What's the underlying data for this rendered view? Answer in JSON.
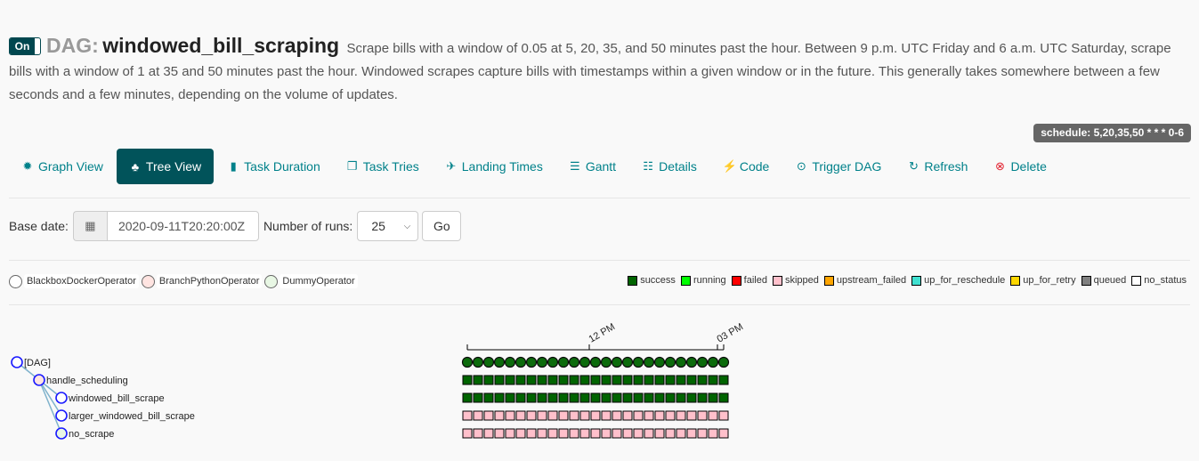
{
  "header": {
    "toggle_label": "On",
    "dag_prefix": "DAG:",
    "dag_id": "windowed_bill_scraping",
    "description": "Scrape bills with a window of 0.05 at 5, 20, 35, and 50 minutes past the hour. Between 9 p.m. UTC Friday and 6 a.m. UTC Saturday, scrape bills with a window of 1 at 35 and 50 minutes past the hour. Windowed scrapes capture bills with timestamps within a given window or in the future. This generally takes somewhere between a few seconds and a few minutes, depending on the volume of updates.",
    "schedule_badge": "schedule: 5,20,35,50 * * * 0-6"
  },
  "nav": {
    "items": [
      {
        "label": "Graph View",
        "icon": "graph-icon",
        "glyph": "✹",
        "active": false
      },
      {
        "label": "Tree View",
        "icon": "tree-icon",
        "glyph": "♣",
        "active": true
      },
      {
        "label": "Task Duration",
        "icon": "bar-chart-icon",
        "glyph": "▮",
        "active": false
      },
      {
        "label": "Task Tries",
        "icon": "duplicate-icon",
        "glyph": "❐",
        "active": false
      },
      {
        "label": "Landing Times",
        "icon": "plane-icon",
        "glyph": "✈",
        "active": false
      },
      {
        "label": "Gantt",
        "icon": "gantt-icon",
        "glyph": "☰",
        "active": false
      },
      {
        "label": "Details",
        "icon": "list-icon",
        "glyph": "☷",
        "active": false
      },
      {
        "label": "Code",
        "icon": "flash-icon",
        "glyph": "⚡",
        "active": false
      },
      {
        "label": "Trigger DAG",
        "icon": "play-circle-icon",
        "glyph": "⊙",
        "active": false
      },
      {
        "label": "Refresh",
        "icon": "refresh-icon",
        "glyph": "↻",
        "active": false
      },
      {
        "label": "Delete",
        "icon": "remove-circle-icon",
        "glyph": "⊗",
        "active": false
      }
    ]
  },
  "form": {
    "base_date_label": "Base date:",
    "calendar_glyph": "▦",
    "base_date_value": "2020-09-11T20:20:00Z",
    "num_runs_label": "Number of runs:",
    "num_runs_value": "25",
    "chevron_glyph": "⌄",
    "go_label": "Go"
  },
  "operator_legend": [
    {
      "label": "BlackboxDockerOperator",
      "color": "#ffffff"
    },
    {
      "label": "BranchPythonOperator",
      "color": "#ffe4e1"
    },
    {
      "label": "DummyOperator",
      "color": "#e8f7e4"
    }
  ],
  "state_legend": [
    {
      "label": "success",
      "color": "#006400"
    },
    {
      "label": "running",
      "color": "#00ff00"
    },
    {
      "label": "failed",
      "color": "#ff0000"
    },
    {
      "label": "skipped",
      "color": "#ffc0cb"
    },
    {
      "label": "upstream_failed",
      "color": "#ffa500"
    },
    {
      "label": "up_for_reschedule",
      "color": "#40e0d0"
    },
    {
      "label": "up_for_retry",
      "color": "#ffd700"
    },
    {
      "label": "queued",
      "color": "#808080"
    },
    {
      "label": "no_status",
      "color": "#ffffff"
    }
  ],
  "tree": {
    "axis_ticks": [
      {
        "label": "12 PM",
        "run_index": 11
      },
      {
        "label": "03 PM",
        "run_index": 23
      }
    ],
    "num_runs": 25,
    "nodes": [
      {
        "label": "[DAG]",
        "depth": 0,
        "operator_color": "#ffffff",
        "kind": "dag_run",
        "state": "success"
      },
      {
        "label": "handle_scheduling",
        "depth": 1,
        "operator_color": "#ffe4e1",
        "kind": "task",
        "state": "success"
      },
      {
        "label": "windowed_bill_scrape",
        "depth": 2,
        "operator_color": "#ffffff",
        "kind": "task",
        "state": "success"
      },
      {
        "label": "larger_windowed_bill_scrape",
        "depth": 2,
        "operator_color": "#ffffff",
        "kind": "task",
        "state": "skipped"
      },
      {
        "label": "no_scrape",
        "depth": 2,
        "operator_color": "#e8f7e4",
        "kind": "task",
        "state": "skipped"
      }
    ]
  }
}
